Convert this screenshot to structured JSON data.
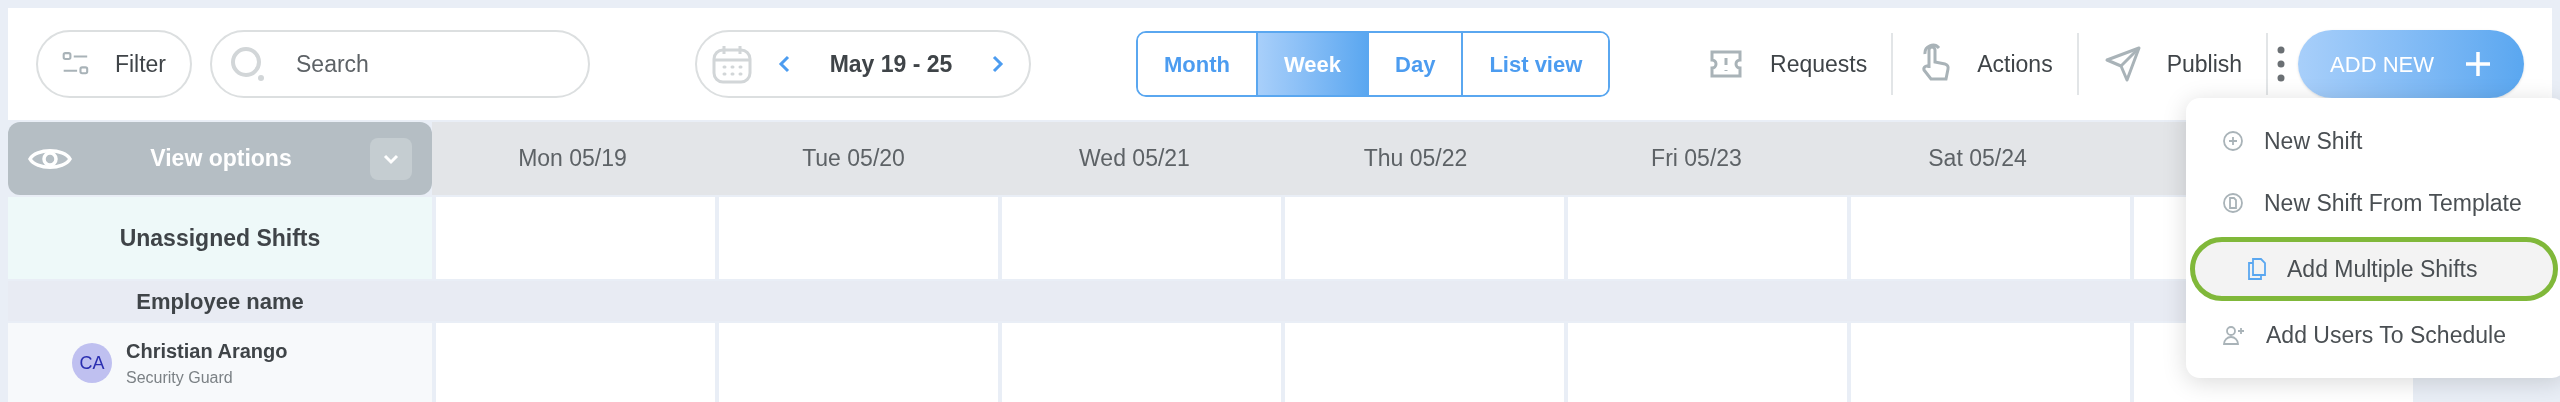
{
  "toolbar": {
    "filter": "Filter",
    "search": {
      "placeholder": "Search"
    },
    "date_range": "May 19 - 25",
    "views": [
      {
        "label": "Month",
        "selected": false
      },
      {
        "label": "Week",
        "selected": true
      },
      {
        "label": "Day",
        "selected": false
      },
      {
        "label": "List view",
        "selected": false
      }
    ],
    "actions": [
      {
        "kind": "requests",
        "label": "Requests"
      },
      {
        "kind": "actions",
        "label": "Actions"
      },
      {
        "kind": "publish",
        "label": "Publish"
      }
    ],
    "add_new": "ADD NEW"
  },
  "schedule": {
    "view_options": "View options",
    "days": [
      "Mon 05/19",
      "Tue 05/20",
      "Wed 05/21",
      "Thu 05/22",
      "Fri 05/23",
      "Sat 05/24"
    ],
    "unassigned": "Unassigned Shifts",
    "employee_header": "Employee name",
    "employees": [
      {
        "initials": "CA",
        "name": "Christian Arango",
        "role": "Security Guard"
      }
    ]
  },
  "menu": {
    "items": [
      {
        "kind": "new",
        "label": "New Shift",
        "highlighted": false
      },
      {
        "kind": "template",
        "label": "New Shift From Template",
        "highlighted": false
      },
      {
        "kind": "multiple",
        "label": "Add Multiple Shifts",
        "highlighted": true
      },
      {
        "kind": "users",
        "label": "Add Users To Schedule",
        "highlighted": false
      }
    ]
  }
}
